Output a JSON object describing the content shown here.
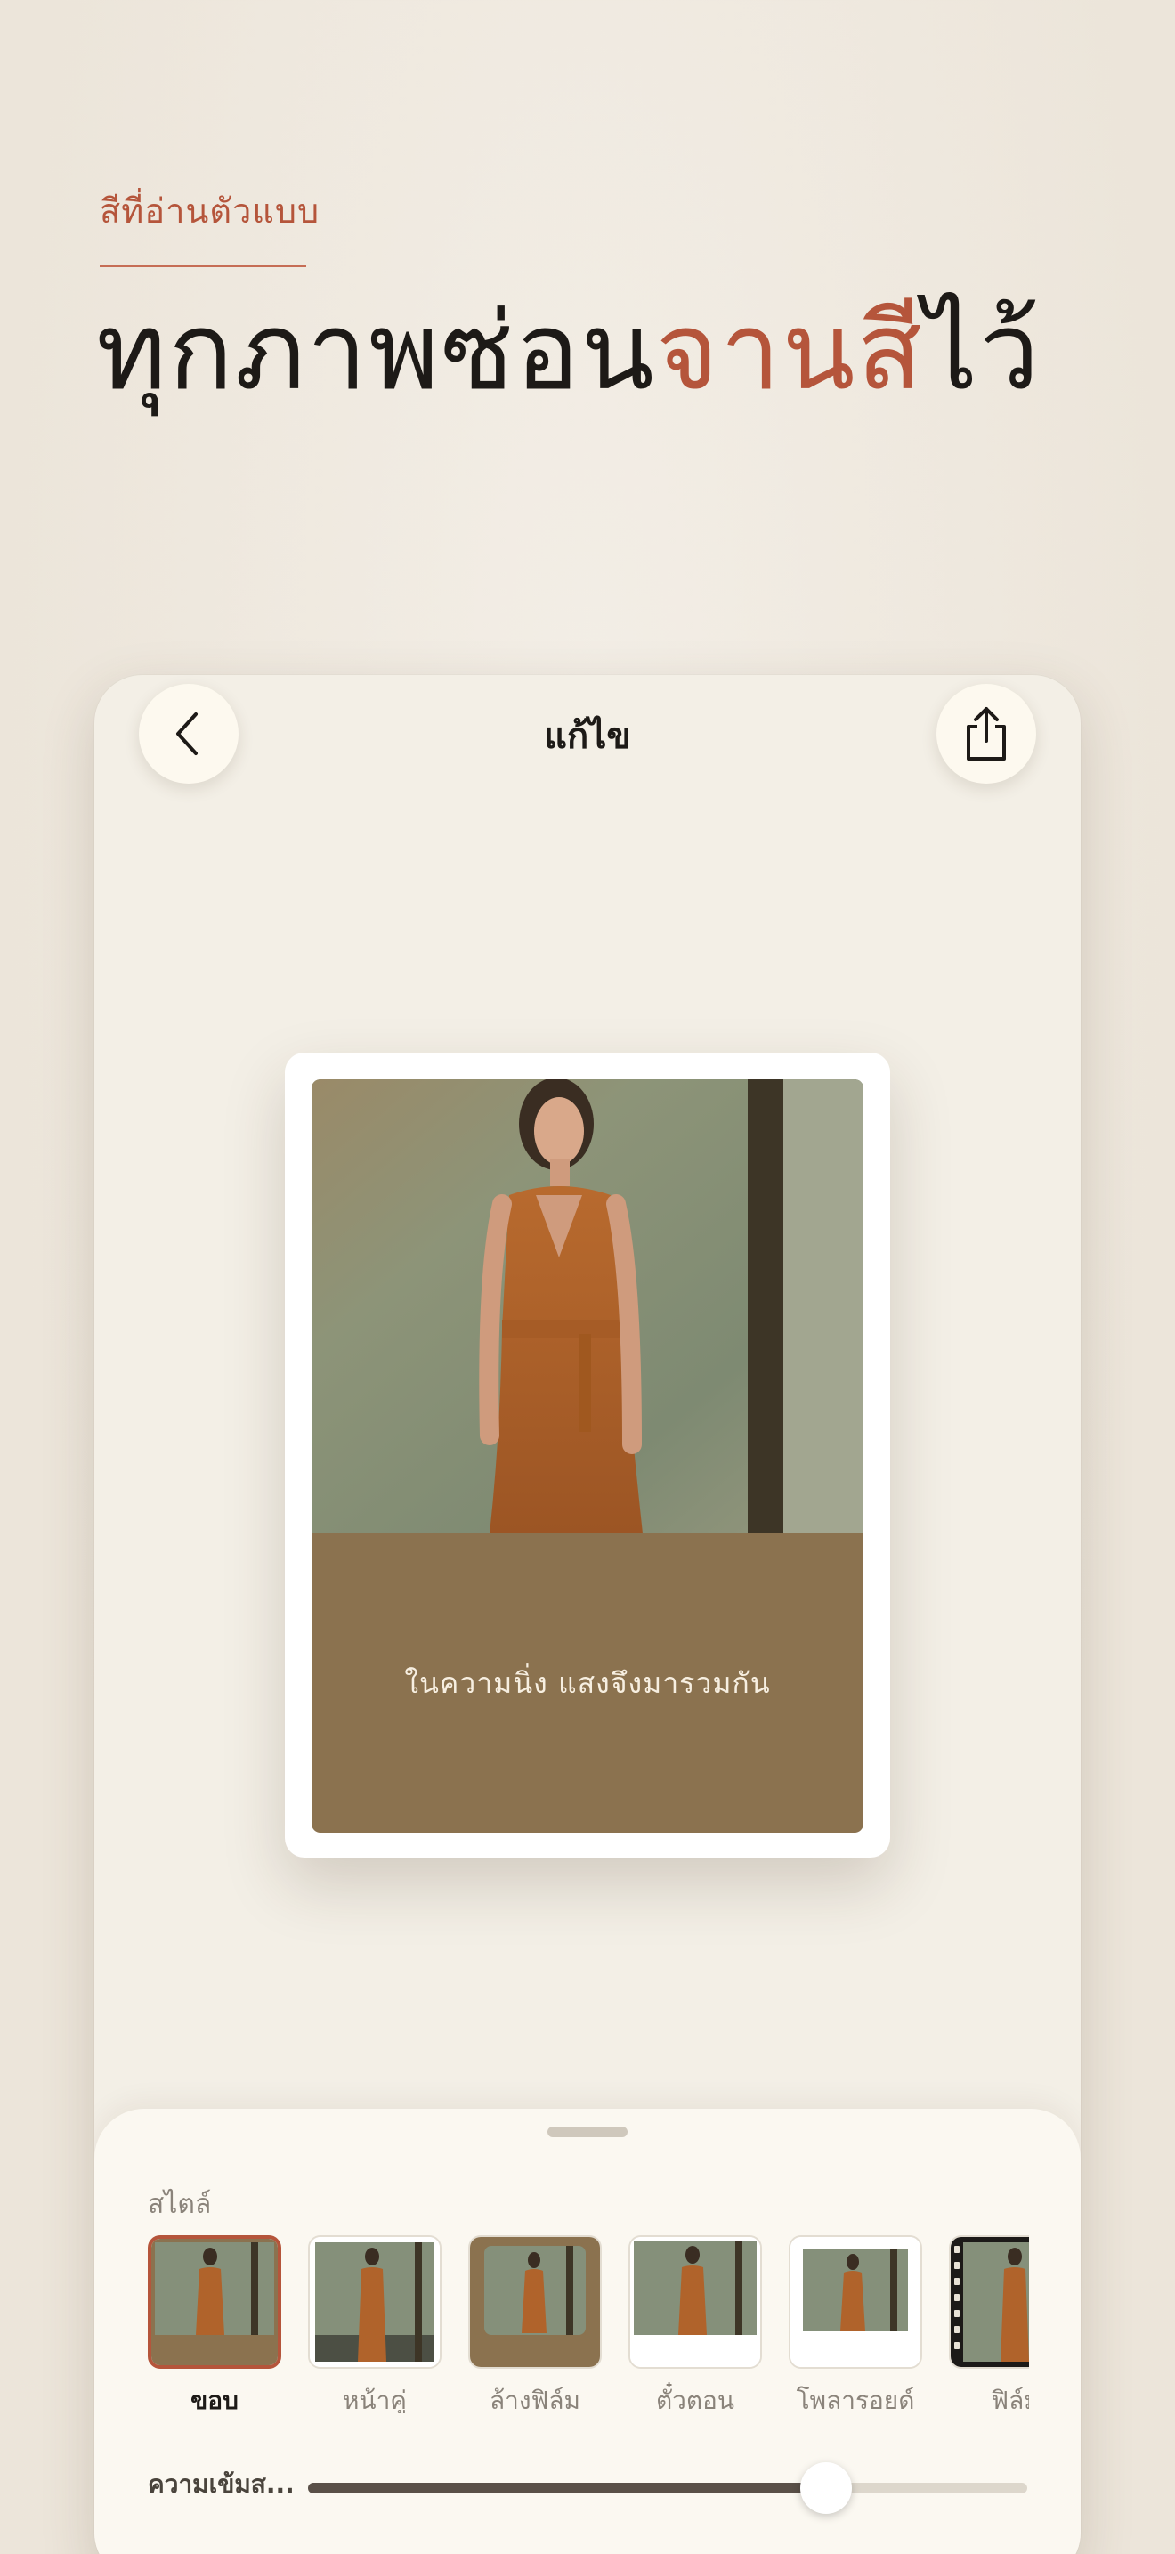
{
  "promo": {
    "eyebrow": "สีที่อ่านตัวแบบ",
    "headline_part1": "ทุกภาพซ่อน",
    "headline_accent": "จานสี",
    "headline_part2": "ไว้"
  },
  "editor": {
    "title": "แก้ไข",
    "back_icon": "chevron-left-icon",
    "share_icon": "share-icon",
    "caption": "ในความนิ่ง  แสงจึงมารวมกัน"
  },
  "style_panel": {
    "label": "สไตล์",
    "styles": [
      {
        "name": "ขอบ",
        "selected": true
      },
      {
        "name": "หน้าคู่",
        "selected": false
      },
      {
        "name": "ล้างฟิล์ม",
        "selected": false
      },
      {
        "name": "ตั๋วตอน",
        "selected": false
      },
      {
        "name": "โพลารอยด์",
        "selected": false
      },
      {
        "name": "ฟิล์ม",
        "selected": false
      }
    ],
    "slider_label": "ความเข้มส...",
    "slider_value": 0.72
  },
  "colors": {
    "accent": "#b5553b",
    "caption_band": "#8b724f",
    "background": "#efe9df"
  }
}
